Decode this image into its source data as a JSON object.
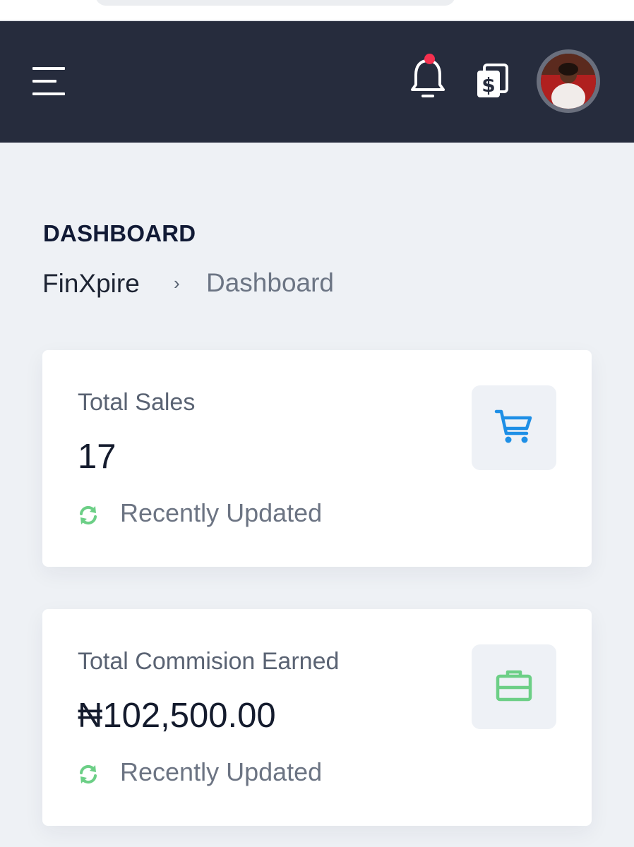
{
  "header": {
    "menu_icon": "menu-icon",
    "notification_icon": "bell-icon",
    "notification_indicator_color": "#f5304f",
    "currency_icon": "money-cards-icon",
    "avatar_icon": "user-avatar"
  },
  "page": {
    "title": "DASHBOARD",
    "breadcrumb": {
      "home": "FinXpire",
      "separator": "›",
      "current": "Dashboard"
    }
  },
  "cards": [
    {
      "label": "Total Sales",
      "value": "17",
      "status": "Recently Updated",
      "icon": "shopping-cart-icon",
      "icon_color": "#1e8fe6"
    },
    {
      "label": "Total Commision Earned",
      "value": "₦102,500.00",
      "status": "Recently Updated",
      "icon": "briefcase-icon",
      "icon_color": "#6ccf86"
    }
  ],
  "colors": {
    "topbar": "#262c3d",
    "background": "#eef1f5",
    "status_icon": "#6ccf86"
  }
}
